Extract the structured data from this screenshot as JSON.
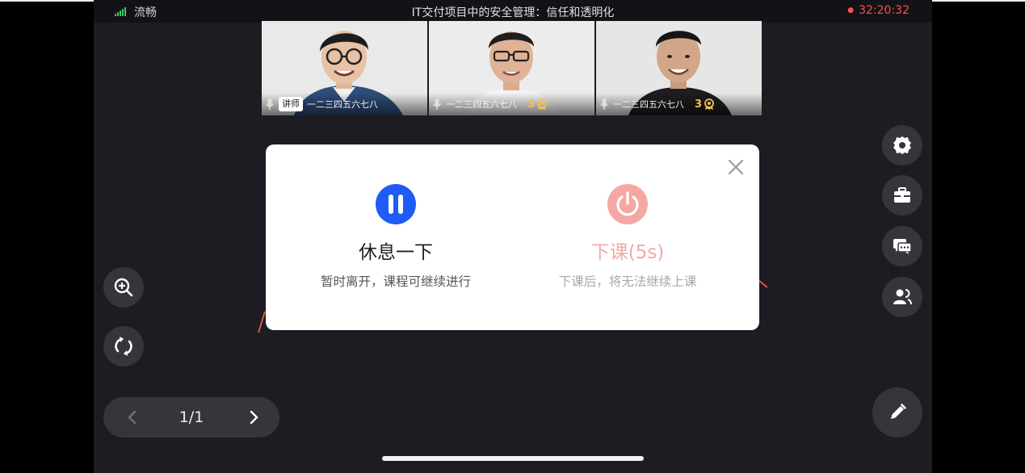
{
  "status_bar": {
    "network_label": "流畅",
    "course_title": "IT交付项目中的安全管理：信任和透明化",
    "timer": "32:20:32"
  },
  "video_tiles": [
    {
      "teacher_badge": "讲师",
      "name": "一二三四五六七八",
      "score": null
    },
    {
      "teacher_badge": null,
      "name": "一二三四五六七八",
      "score": "3"
    },
    {
      "teacher_badge": null,
      "name": "一二三四五六七八",
      "score": "3"
    }
  ],
  "dialog": {
    "take_break": {
      "title": "休息一下",
      "description": "暂时离开，课程可继续进行",
      "icon": "pause-icon",
      "color": "#1e5cf5"
    },
    "end_class": {
      "title": "下课(5s)",
      "description": "下课后，将无法继续上课",
      "icon": "power-icon",
      "color": "#f5a7a4"
    },
    "close_icon": "close-icon"
  },
  "right_toolbar": [
    "settings-icon",
    "toolbox-icon",
    "chat-icon",
    "members-icon",
    "pen-icon"
  ],
  "left_toolbar": [
    "zoom-in-icon",
    "rotate-icon"
  ],
  "pager": {
    "current": "1/1"
  },
  "colors": {
    "screen_bg": "#1c1c22",
    "button_bg": "#35363c",
    "timer": "#ff4d4f",
    "signal": "#39c36a"
  }
}
